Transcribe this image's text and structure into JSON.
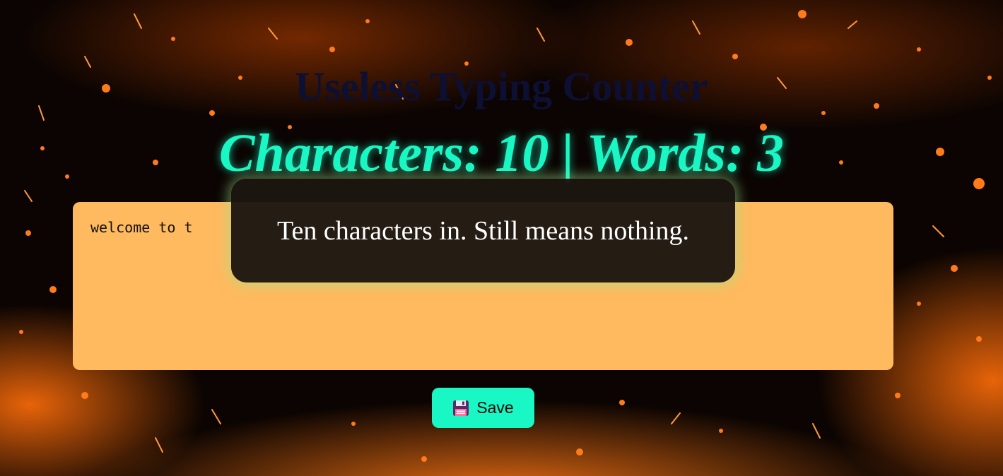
{
  "header": {
    "title": "Useless Typing Counter"
  },
  "counter": {
    "text": "Characters: 10 | Words: 3"
  },
  "editor": {
    "value": "welcome to t"
  },
  "toast": {
    "message": "Ten characters in. Still means nothing."
  },
  "toolbar": {
    "save_label": "Save",
    "save_icon": "floppy-disk-icon"
  },
  "colors": {
    "accent": "#18f7c4",
    "editor_bg": "#ffb95e",
    "title": "#0d0f33",
    "toast_bg": "#1c1610"
  }
}
